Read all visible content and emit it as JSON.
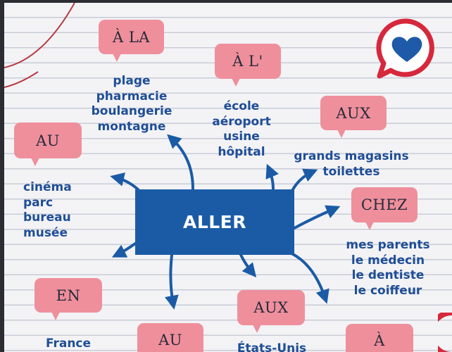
{
  "center": {
    "label": "ALLER"
  },
  "bubbles": {
    "a_la": "À LA",
    "a_l": "À L'",
    "aux_top": "AUX",
    "au_left": "AU",
    "chez": "CHEZ",
    "en": "EN",
    "au_bottom": "AU",
    "aux_bottom": "AUX",
    "a_bottom": "À"
  },
  "lists": {
    "a_la": [
      "plage",
      "pharmacie",
      "boulangerie",
      "montagne"
    ],
    "a_l": [
      "école",
      "aéroport",
      "usine",
      "hôpital"
    ],
    "aux_top": [
      "grands magasins",
      "toilettes"
    ],
    "au_left": [
      "cinéma",
      "parc",
      "bureau",
      "musée"
    ],
    "chez": [
      "mes parents",
      "le médecin",
      "le dentiste",
      "le coiffeur"
    ],
    "en": [
      "France"
    ],
    "aux_bottom": [
      "États-Unis"
    ]
  },
  "colors": {
    "bubble": "#ef8f9c",
    "text_blue": "#1f4e96",
    "center_box": "#1b5ba6",
    "badge_red": "#d6283c",
    "heart": "#1e5aa8"
  },
  "icons": {
    "badge": "heart-chat-icon"
  }
}
